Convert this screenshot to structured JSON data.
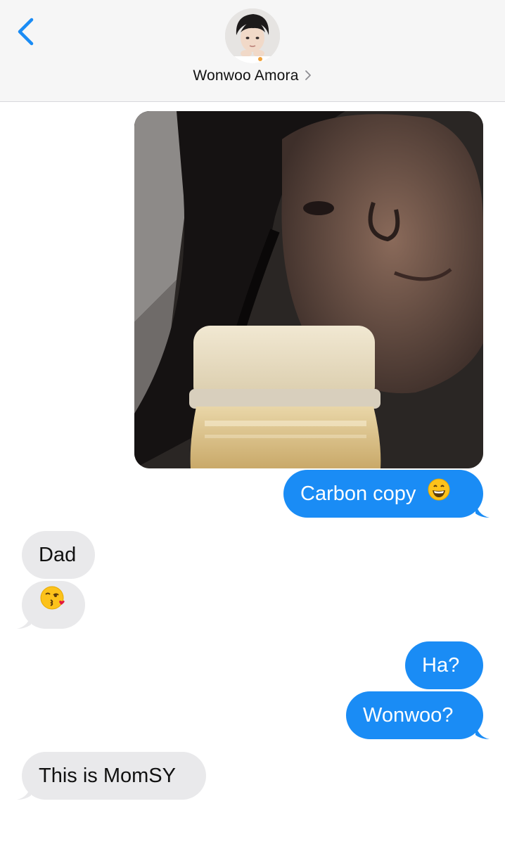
{
  "header": {
    "contact_name": "Wonwoo Amora",
    "back_icon": "chevron-left-icon",
    "details_icon": "chevron-right-icon"
  },
  "messages": [
    {
      "direction": "outgoing",
      "type": "image",
      "content": "photo"
    },
    {
      "direction": "outgoing",
      "type": "text",
      "text": "Carbon copy",
      "emoji": "grinning-face"
    },
    {
      "direction": "incoming",
      "type": "text",
      "text": "Dad"
    },
    {
      "direction": "incoming",
      "type": "emoji",
      "emoji": "face-blowing-a-kiss"
    },
    {
      "direction": "outgoing",
      "type": "text",
      "text": "Ha?"
    },
    {
      "direction": "outgoing",
      "type": "text",
      "text": "Wonwoo?"
    },
    {
      "direction": "incoming",
      "type": "text",
      "text": "This is MomSY"
    }
  ],
  "colors": {
    "outgoing_bubble": "#1a8cf5",
    "incoming_bubble": "#e9e9eb",
    "accent": "#1a8cf5",
    "header_bg": "#f6f6f6"
  }
}
